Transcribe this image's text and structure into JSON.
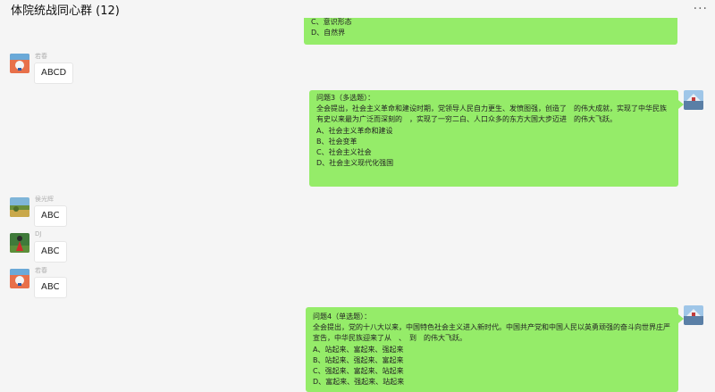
{
  "header": {
    "title": "体院统战同心群 (12)",
    "more": "..."
  },
  "messages": {
    "m0": {
      "lines": [
        "C、意识形态",
        "D、自然界"
      ]
    },
    "m1": {
      "sender": "若春",
      "text": "ABCD"
    },
    "m2": {
      "lines": [
        "问题3（多选题）：",
        "全会提出，社会主义革命和建设时期，党领导人民自力更生、发愤图强，创造了　的伟大成就，实现了中华民族有史以来最为广泛而深刻的　，实现了一穷二白、人口众多的东方大国大步迈进　的伟大飞跃。",
        "A、社会主义革命和建设",
        "B、社会变革",
        "C、社会主义社会",
        "D、社会主义现代化强国"
      ]
    },
    "m3": {
      "sender": "侯光辉",
      "text": "ABC"
    },
    "m4": {
      "sender": "DJ",
      "text": "ABC"
    },
    "m5": {
      "sender": "若春",
      "text": "ABC"
    },
    "m6": {
      "lines": [
        "问题4（单选题）：",
        "全会提出，党的十八大以来，中国特色社会主义进入新时代。中国共产党和中国人民以英勇顽强的奋斗向世界庄严宣告，中华民族迎来了从　、　到　的伟大飞跃。",
        "A、站起来、富起来、强起来",
        "B、站起来、强起来、富起来",
        "C、强起来、富起来、站起来",
        "D、富起来、强起来、站起来"
      ]
    }
  }
}
